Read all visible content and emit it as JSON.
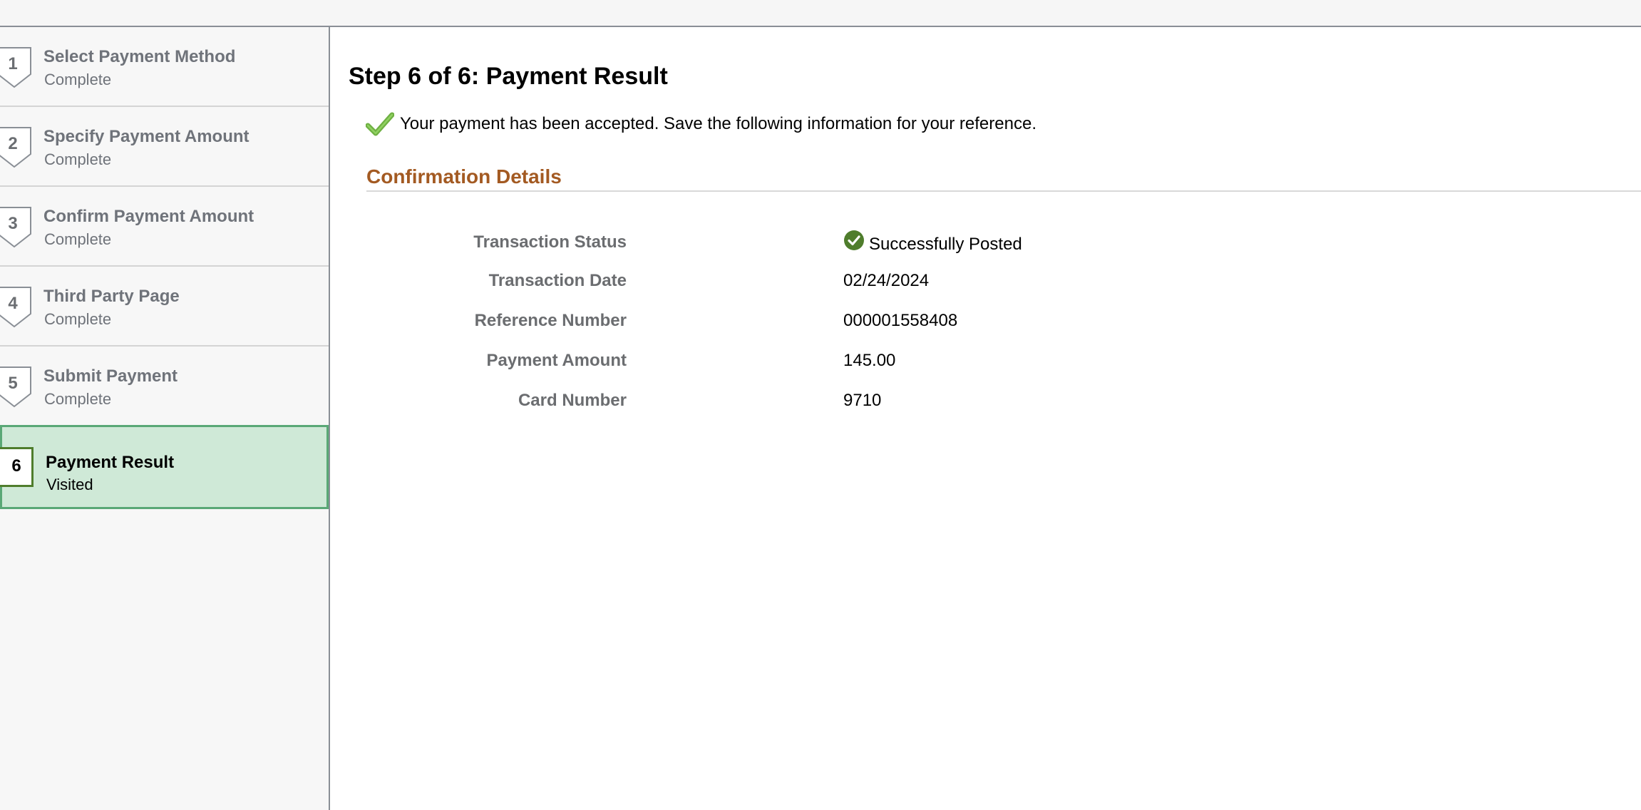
{
  "sidebar": {
    "steps": [
      {
        "number": "1",
        "title": "Select Payment Method",
        "status": "Complete"
      },
      {
        "number": "2",
        "title": "Specify Payment Amount",
        "status": "Complete"
      },
      {
        "number": "3",
        "title": "Confirm Payment Amount",
        "status": "Complete"
      },
      {
        "number": "4",
        "title": "Third Party Page",
        "status": "Complete"
      },
      {
        "number": "5",
        "title": "Submit Payment",
        "status": "Complete"
      },
      {
        "number": "6",
        "title": "Payment Result",
        "status": "Visited",
        "active": true
      }
    ]
  },
  "main": {
    "title": "Step 6 of 6: Payment Result",
    "message": "Your payment has been accepted. Save the following information for your reference.",
    "section_title": "Confirmation Details",
    "details": [
      {
        "label": "Transaction Status",
        "value": "Successfully Posted",
        "icon": "check-circle-icon"
      },
      {
        "label": "Transaction Date",
        "value": "02/24/2024"
      },
      {
        "label": "Reference Number",
        "value": "000001558408"
      },
      {
        "label": "Payment Amount",
        "value": "145.00"
      },
      {
        "label": "Card Number",
        "value": "9710"
      }
    ]
  },
  "colors": {
    "active_step_bg": "#cfe9d7",
    "active_step_border": "#5aa876",
    "section_title": "#a35a22",
    "success_green": "#4f7d2c"
  }
}
